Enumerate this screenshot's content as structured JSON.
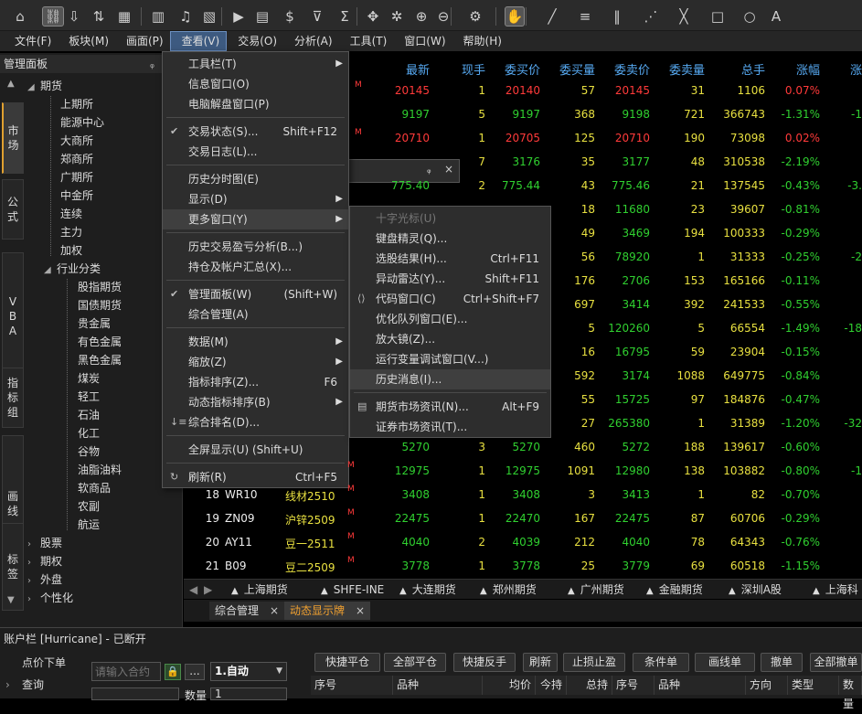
{
  "toolbar": {
    "icons": [
      "home-icon",
      "link-icon",
      "download-icon",
      "sort-icon",
      "grid-icon",
      "chart-bar-icon",
      "bell-icon",
      "trend-chart-icon",
      "play-icon",
      "document-icon",
      "dollar-icon",
      "filter-icon",
      "sum-icon",
      "move-icon",
      "wand-icon",
      "zoom-in-icon",
      "zoom-out-icon",
      "settings-icon",
      "hand-icon",
      "line-icon",
      "parallel-lines-icon",
      "vertical-lines-icon",
      "fan-icon",
      "cross-lines-icon",
      "rectangle-icon",
      "circle-icon",
      "text-icon"
    ]
  },
  "menubar": {
    "items": [
      "文件(F)",
      "板块(M)",
      "画面(P)",
      "查看(V)",
      "交易(O)",
      "分析(A)",
      "工具(T)",
      "窗口(W)",
      "帮助(H)"
    ]
  },
  "panel": {
    "title": "管理面板",
    "pin": "ᵩ",
    "close": "×",
    "vtabs": [
      "市场",
      "公式",
      "VBA",
      "指标组",
      "画线",
      "标签"
    ],
    "tree": {
      "futures": "期货",
      "futures_children": [
        "上期所",
        "能源中心",
        "大商所",
        "郑商所",
        "广期所",
        "中金所",
        "连续",
        "主力",
        "加权"
      ],
      "industry": "行业分类",
      "industry_children": [
        "股指期货",
        "国债期货",
        "贵金属",
        "有色金属",
        "黑色金属",
        "煤炭",
        "轻工",
        "石油",
        "化工",
        "谷物",
        "油脂油料",
        "软商品",
        "农副",
        "航运"
      ],
      "others": [
        "股票",
        "期权",
        "外盘",
        "个性化"
      ]
    }
  },
  "grid": {
    "headers": [
      "最新",
      "现手",
      "委买价",
      "委买量",
      "委卖价",
      "委卖量",
      "总手",
      "涨幅",
      "涨"
    ],
    "top_rows": [
      {
        "last": "20145",
        "vol": "1",
        "bid": "20140",
        "bidq": "57",
        "ask": "20145",
        "askq": "31",
        "total": "1106",
        "chg": "0.07%",
        "chg2": "",
        "color": "red",
        "m": true
      },
      {
        "last": "9197",
        "vol": "5",
        "bid": "9197",
        "bidq": "368",
        "ask": "9198",
        "askq": "721",
        "total": "366743",
        "chg": "-1.31%",
        "chg2": "-1",
        "color": "green",
        "m": false
      },
      {
        "last": "20710",
        "vol": "1",
        "bid": "20705",
        "bidq": "125",
        "ask": "20710",
        "askq": "190",
        "total": "73098",
        "chg": "0.02%",
        "chg2": "",
        "color": "red",
        "m": true
      },
      {
        "last": "",
        "vol": "7",
        "bid": "3176",
        "bidq": "35",
        "ask": "3177",
        "askq": "48",
        "total": "310538",
        "chg": "-2.19%",
        "chg2": "",
        "color": "green",
        "m": false
      },
      {
        "last": "775.40",
        "vol": "2",
        "bid": "775.44",
        "bidq": "43",
        "ask": "775.46",
        "askq": "21",
        "total": "137545",
        "chg": "-0.43%",
        "chg2": "-3.",
        "color": "green",
        "m": false
      }
    ],
    "mid_rows": [
      {
        "ask": "11680",
        "askq": "23",
        "total": "39607",
        "chg": "-0.81%",
        "bidq": "18"
      },
      {
        "ask": "3469",
        "askq": "194",
        "total": "100333",
        "chg": "-0.29%",
        "bidq": "49"
      },
      {
        "ask": "78920",
        "askq": "1",
        "total": "31333",
        "chg": "-0.25%",
        "bidq": "56",
        "chg2": "-2"
      },
      {
        "ask": "2706",
        "askq": "153",
        "total": "165166",
        "chg": "-0.11%",
        "bidq": "176"
      },
      {
        "ask": "3414",
        "askq": "392",
        "total": "241533",
        "chg": "-0.55%",
        "bidq": "697"
      },
      {
        "ask": "120260",
        "askq": "5",
        "total": "66554",
        "chg": "-1.49%",
        "bidq": "5",
        "chg2": "-18"
      },
      {
        "ask": "16795",
        "askq": "59",
        "total": "23904",
        "chg": "-0.15%",
        "bidq": "16"
      },
      {
        "ask": "3174",
        "askq": "1088",
        "total": "649775",
        "chg": "-0.84%",
        "bidq": "592"
      },
      {
        "ask": "15725",
        "askq": "97",
        "total": "184876",
        "chg": "-0.47%",
        "bidq": "55"
      },
      {
        "ask": "265380",
        "askq": "1",
        "total": "31389",
        "chg": "-1.20%",
        "bidq": "27",
        "chg2": "-32"
      }
    ],
    "bottom_rows": [
      {
        "no": "",
        "code": "",
        "name": "",
        "last": "5270",
        "vol": "3",
        "bid": "5270",
        "bidq": "460",
        "ask": "5272",
        "askq": "188",
        "total": "139617",
        "chg": "-0.60%",
        "chg2": "",
        "m": false
      },
      {
        "no": "",
        "code": "",
        "name": "",
        "last": "12975",
        "vol": "1",
        "bid": "12975",
        "bidq": "1091",
        "ask": "12980",
        "askq": "138",
        "total": "103882",
        "chg": "-0.80%",
        "chg2": "-1",
        "m": true
      },
      {
        "no": "18",
        "code": "WR10",
        "name": "线材2510",
        "last": "3408",
        "vol": "1",
        "bid": "3408",
        "bidq": "3",
        "ask": "3413",
        "askq": "1",
        "total": "82",
        "chg": "-0.70%",
        "chg2": "",
        "m": true
      },
      {
        "no": "19",
        "code": "ZN09",
        "name": "沪锌2509",
        "last": "22475",
        "vol": "1",
        "bid": "22470",
        "bidq": "167",
        "ask": "22475",
        "askq": "87",
        "total": "60706",
        "chg": "-0.29%",
        "chg2": "",
        "m": true
      },
      {
        "no": "20",
        "code": "AY11",
        "name": "豆一2511",
        "last": "4040",
        "vol": "2",
        "bid": "4039",
        "bidq": "212",
        "ask": "4040",
        "askq": "78",
        "total": "64343",
        "chg": "-0.76%",
        "chg2": "",
        "m": true
      },
      {
        "no": "21",
        "code": "B09",
        "name": "豆二2509",
        "last": "3778",
        "vol": "1",
        "bid": "3778",
        "bidq": "25",
        "ask": "3779",
        "askq": "69",
        "total": "60518",
        "chg": "-1.15%",
        "chg2": "",
        "m": true
      }
    ],
    "m_mark": "M"
  },
  "view_menu": {
    "items": [
      {
        "label": "工具栏(T)",
        "shortcut": "",
        "sub": true,
        "check": false
      },
      {
        "label": "信息窗口(O)",
        "shortcut": "",
        "sub": false,
        "check": false
      },
      {
        "label": "电脑解盘窗口(P)",
        "shortcut": "",
        "sub": false,
        "check": false
      },
      {
        "sep": true
      },
      {
        "label": "交易状态(S)...",
        "shortcut": "Shift+F12",
        "sub": false,
        "check": true
      },
      {
        "label": "交易日志(L)...",
        "shortcut": "",
        "sub": false,
        "check": false
      },
      {
        "sep": true
      },
      {
        "label": "历史分时图(E)",
        "shortcut": "",
        "sub": false,
        "check": false
      },
      {
        "label": "显示(D)",
        "shortcut": "",
        "sub": true,
        "check": false
      },
      {
        "label": "更多窗口(Y)",
        "shortcut": "",
        "sub": true,
        "check": false,
        "hl": true
      },
      {
        "sep": true
      },
      {
        "label": "历史交易盈亏分析(B...)",
        "shortcut": "",
        "sub": false,
        "check": false
      },
      {
        "label": "持仓及帐户汇总(X)...",
        "shortcut": "",
        "sub": false,
        "check": false
      },
      {
        "sep": true
      },
      {
        "label": "管理面板(W)",
        "shortcut": "(Shift+W)",
        "sub": false,
        "check": true
      },
      {
        "label": "综合管理(A)",
        "shortcut": "",
        "sub": false,
        "check": false
      },
      {
        "sep": true
      },
      {
        "label": "数据(M)",
        "shortcut": "",
        "sub": true,
        "check": false
      },
      {
        "label": "缩放(Z)",
        "shortcut": "",
        "sub": true,
        "check": false
      },
      {
        "label": "指标排序(Z)...",
        "shortcut": "F6",
        "sub": false,
        "check": false
      },
      {
        "label": "动态指标排序(B)",
        "shortcut": "",
        "sub": true,
        "check": false
      },
      {
        "label": "综合排名(D)...",
        "shortcut": "",
        "sub": false,
        "check": false,
        "icon": "sort-rank-icon"
      },
      {
        "sep": true
      },
      {
        "label": "全屏显示(U) (Shift+U)",
        "shortcut": "",
        "sub": false,
        "check": false
      },
      {
        "sep": true
      },
      {
        "label": "刷新(R)",
        "shortcut": "Ctrl+F5",
        "sub": false,
        "check": false,
        "icon": "refresh-icon"
      }
    ]
  },
  "more_menu": {
    "items": [
      {
        "label": "十字光标(U)",
        "shortcut": "",
        "dis": true
      },
      {
        "label": "键盘精灵(Q)...",
        "shortcut": ""
      },
      {
        "label": "选股结果(H)...",
        "shortcut": "Ctrl+F11"
      },
      {
        "label": "异动雷达(Y)...",
        "shortcut": "Shift+F11"
      },
      {
        "label": "代码窗口(C)",
        "shortcut": "Ctrl+Shift+F7",
        "icon": "code-icon"
      },
      {
        "label": "优化队列窗口(E)...",
        "shortcut": ""
      },
      {
        "label": "放大镜(Z)...",
        "shortcut": ""
      },
      {
        "label": "运行变量调试窗口(V...)",
        "shortcut": ""
      },
      {
        "label": "历史消息(I)...",
        "shortcut": "",
        "hl": true
      },
      {
        "sep": true
      },
      {
        "label": "期货市场资讯(N)...",
        "shortcut": "Alt+F9",
        "icon": "news-icon"
      },
      {
        "label": "证券市场资讯(T)...",
        "shortcut": ""
      }
    ]
  },
  "bottom_tabs": [
    "上海期货",
    "SHFE-INE",
    "大连期货",
    "郑州期货",
    "广州期货",
    "金融期货",
    "深圳A股",
    "上海科"
  ],
  "window_tabs": [
    "综合管理",
    "动态显示牌"
  ],
  "account": {
    "title": "账户栏 [Hurricane]  - 已断开",
    "left_items": [
      "点价下单",
      "查询"
    ],
    "contract_placeholder": "请输入合约",
    "mode_value": "1.自动",
    "qty_label": "数量",
    "qty_value": "1",
    "buttons": [
      "快捷平仓",
      "全部平仓",
      "快捷反手",
      "刷新",
      "止损止盈",
      "条件单",
      "画线单",
      "撤单",
      "全部撤单"
    ],
    "columns": [
      "序号",
      "品种",
      "均价",
      "今持",
      "总持",
      "序号",
      "品种",
      "方向",
      "类型",
      "数量"
    ]
  }
}
